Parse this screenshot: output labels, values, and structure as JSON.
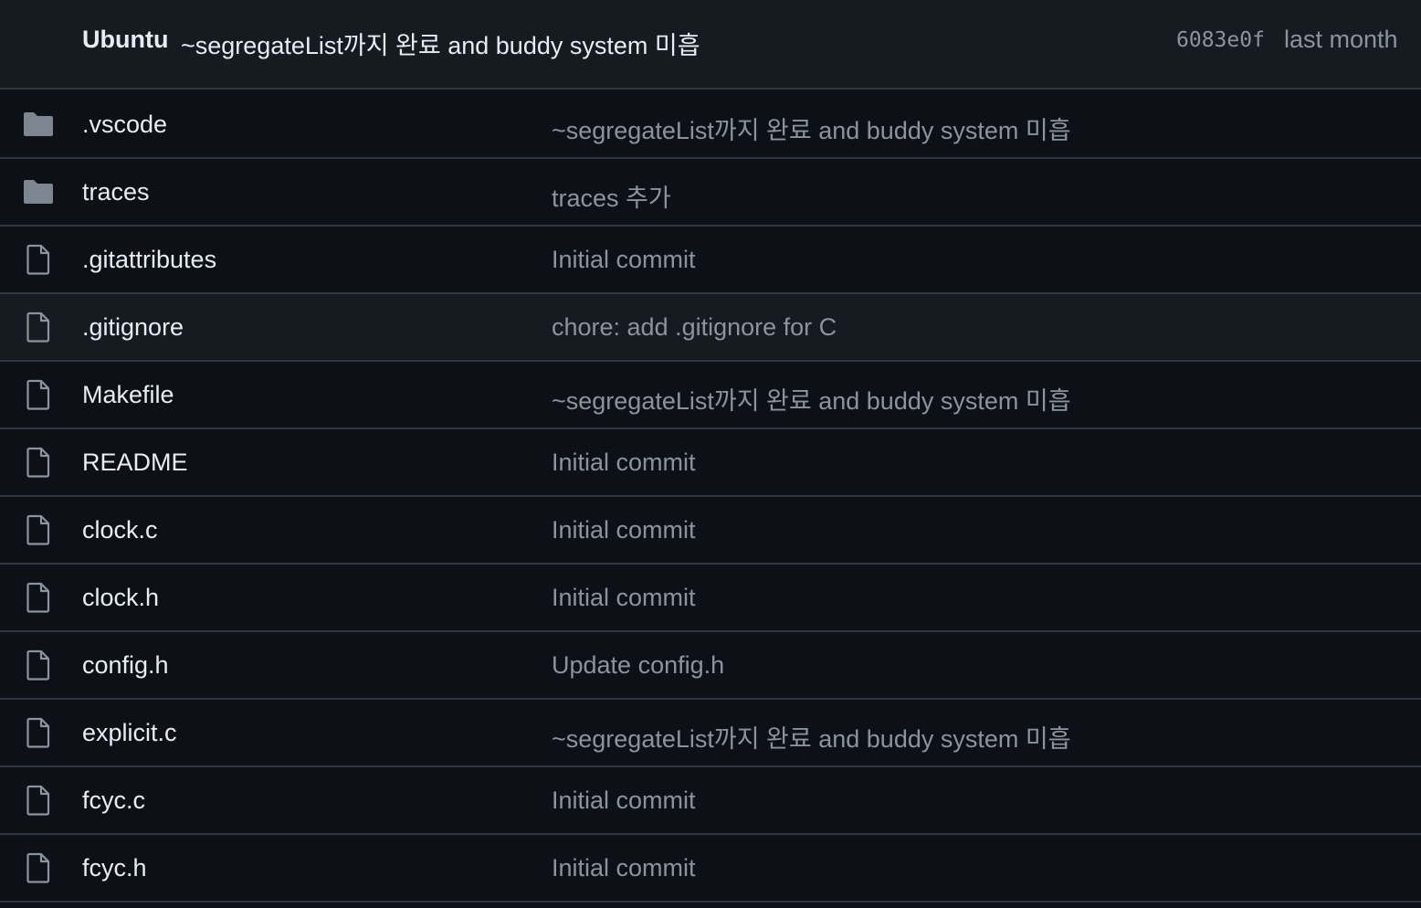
{
  "latest_commit": {
    "author": "Ubuntu",
    "message": "~segregateList까지 완료 and buddy system 미흡",
    "sha": "6083e0f",
    "time": "last month"
  },
  "colors": {
    "background": "#0d1117",
    "header_background": "#161b22",
    "border": "#30363d",
    "text_primary": "#e6edf3",
    "text_muted": "#8b949e",
    "folder_icon": "#7d8590"
  },
  "files": [
    {
      "name": ".vscode",
      "type": "folder",
      "icon": "folder-icon",
      "commit": "~segregateList까지 완료 and buddy system 미흡"
    },
    {
      "name": "traces",
      "type": "folder",
      "icon": "folder-icon",
      "commit": "traces 추가"
    },
    {
      "name": ".gitattributes",
      "type": "file",
      "icon": "file-icon",
      "commit": "Initial commit"
    },
    {
      "name": ".gitignore",
      "type": "file",
      "icon": "file-icon",
      "commit": "chore: add .gitignore for C"
    },
    {
      "name": "Makefile",
      "type": "file",
      "icon": "file-icon",
      "commit": "~segregateList까지 완료 and buddy system 미흡"
    },
    {
      "name": "README",
      "type": "file",
      "icon": "file-icon",
      "commit": "Initial commit"
    },
    {
      "name": "clock.c",
      "type": "file",
      "icon": "file-icon",
      "commit": "Initial commit"
    },
    {
      "name": "clock.h",
      "type": "file",
      "icon": "file-icon",
      "commit": "Initial commit"
    },
    {
      "name": "config.h",
      "type": "file",
      "icon": "file-icon",
      "commit": "Update config.h"
    },
    {
      "name": "explicit.c",
      "type": "file",
      "icon": "file-icon",
      "commit": "~segregateList까지 완료 and buddy system 미흡"
    },
    {
      "name": "fcyc.c",
      "type": "file",
      "icon": "file-icon",
      "commit": "Initial commit"
    },
    {
      "name": "fcyc.h",
      "type": "file",
      "icon": "file-icon",
      "commit": "Initial commit"
    }
  ]
}
